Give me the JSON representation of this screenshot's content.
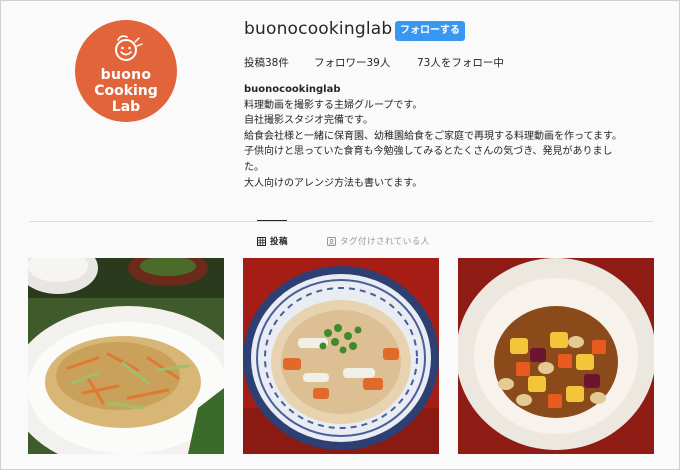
{
  "profile": {
    "username": "buonocookinglab",
    "follow_label": "フォローする",
    "avatar_lines": [
      "buono",
      "Cooking",
      "Lab"
    ],
    "stats": {
      "posts": "投稿38件",
      "followers": "フォロワー39人",
      "following": "73人をフォロー中"
    },
    "bio": {
      "name": "buonocookinglab",
      "lines": [
        "料理動画を撮影する主婦グループです。",
        "自社撮影スタジオ完備です。",
        "給食会社様と一緒に保育園、幼稚園給食をご家庭で再現する料理動画を作ってます。",
        "子供向けと思っていた食育も今勉強してみるとたくさんの気づき、発見がありまし",
        "た。",
        "大人向けのアレンジ方法も書いてます。"
      ]
    }
  },
  "tabs": {
    "posts_label": "投稿",
    "tagged_label": "タグ付けされている人"
  },
  "colors": {
    "accent": "#3897f0",
    "avatar_bg": "#e2643a"
  },
  "icons": {
    "grid": "grid-icon",
    "tag": "tag-icon"
  }
}
